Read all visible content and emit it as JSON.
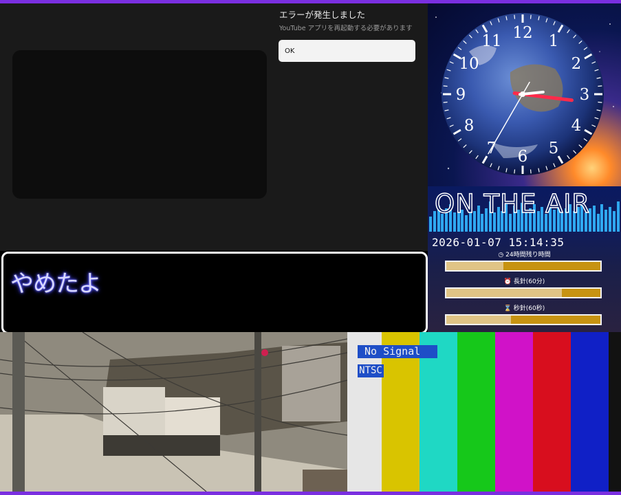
{
  "youtube_error": {
    "title": "エラーが発生しました",
    "message": "YouTube アプリを再起動する必要があります",
    "ok_label": "OK"
  },
  "message_box": {
    "text": "やめたよ"
  },
  "clock": {
    "numerals": [
      "12",
      "1",
      "2",
      "3",
      "4",
      "5",
      "6",
      "7",
      "8",
      "9",
      "10",
      "11"
    ],
    "time_shown": "15:14"
  },
  "on_air": {
    "title": "ON THE AIR",
    "datetime": "2026-01-07 15:14:35",
    "day_remaining_label": "24時間残り時間",
    "day_remaining_fraction": 0.37,
    "minute_hand_label": "長針(60分)",
    "minute_hand_fraction": 0.75,
    "second_hand_label": "秒針(60秒)",
    "second_hand_fraction": 0.42
  },
  "test_signal": {
    "no_signal_label": "No Signal",
    "standard_label": "NTSC",
    "bar_colors": [
      "#e6e6e6",
      "#d9c400",
      "#1fd8c4",
      "#16c81a",
      "#d012c8",
      "#d80e1e",
      "#1020c6",
      "#121212"
    ]
  },
  "colors": {
    "frame_border": "#7a2fe0",
    "message_glow": "#3b3bff",
    "gauge_fill": "#c79312"
  }
}
